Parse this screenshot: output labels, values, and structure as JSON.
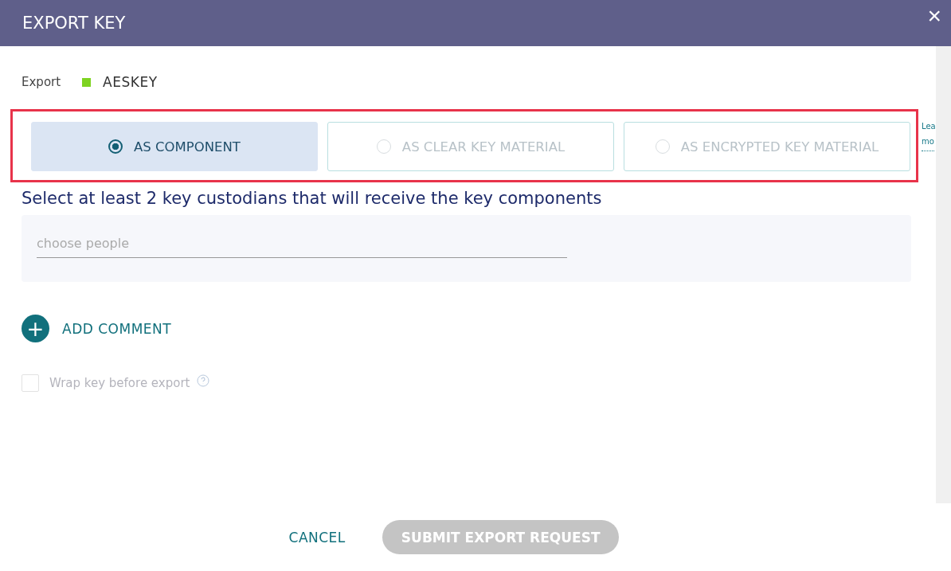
{
  "dialog": {
    "title": "EXPORT KEY",
    "close": "×"
  },
  "export_line": {
    "label": "Export",
    "key_name": "AESKEY",
    "color": "#7ed321"
  },
  "options": [
    {
      "label": "AS COMPONENT",
      "selected": true,
      "disabled": false
    },
    {
      "label": "AS CLEAR KEY MATERIAL",
      "selected": false,
      "disabled": true
    },
    {
      "label": "AS ENCRYPTED KEY MATERIAL",
      "selected": false,
      "disabled": true
    }
  ],
  "side_link": [
    "Lea",
    "mo"
  ],
  "custodians": {
    "heading": "Select at least 2 key custodians that will receive the key components",
    "placeholder": "choose people"
  },
  "add_comment": {
    "icon": "+",
    "label": "ADD COMMENT"
  },
  "wrap_key": {
    "label": "Wrap key before export",
    "checked": false,
    "disabled": true
  },
  "buttons": {
    "cancel": "CANCEL",
    "submit": "SUBMIT EXPORT REQUEST",
    "submit_disabled": true
  }
}
